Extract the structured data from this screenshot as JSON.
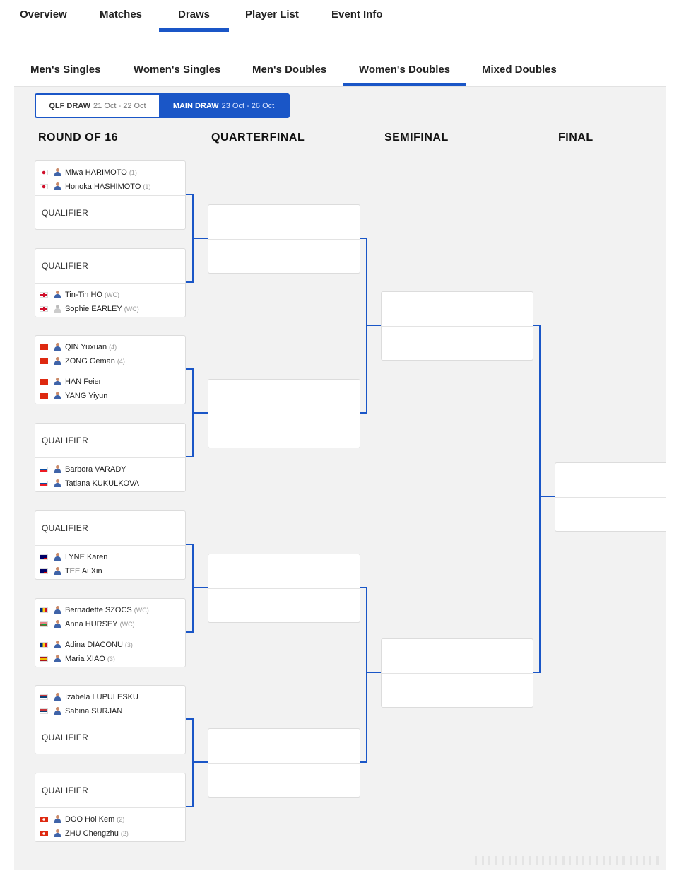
{
  "top_nav": {
    "items": [
      "Overview",
      "Matches",
      "Draws",
      "Player List",
      "Event Info"
    ],
    "active": "Draws"
  },
  "sub_tabs": {
    "items": [
      "Men's Singles",
      "Women's Singles",
      "Men's Doubles",
      "Women's Doubles",
      "Mixed Doubles"
    ],
    "active": "Women's Doubles"
  },
  "draw_toggle": {
    "qlf_label": "QLF DRAW",
    "qlf_dates": "21 Oct - 22 Oct",
    "main_label": "MAIN DRAW",
    "main_dates": "23 Oct - 26 Oct",
    "active": "MAIN DRAW"
  },
  "rounds": [
    "ROUND OF 16",
    "QUARTERFINAL",
    "SEMIFINAL",
    "FINAL"
  ],
  "colors": {
    "accent": "#1a56c7",
    "bracket_line": "#1a56c7",
    "background": "#f2f2f2"
  },
  "round_of_16": [
    {
      "slots": [
        {
          "type": "pair",
          "players": [
            {
              "name": "Miwa HARIMOTO",
              "seed": "(1)",
              "flag": "jp",
              "avatar": "photo"
            },
            {
              "name": "Honoka HASHIMOTO",
              "seed": "(1)",
              "flag": "jp",
              "avatar": "photo"
            }
          ]
        },
        {
          "type": "qualifier",
          "label": "QUALIFIER"
        }
      ]
    },
    {
      "slots": [
        {
          "type": "qualifier",
          "label": "QUALIFIER"
        },
        {
          "type": "pair",
          "players": [
            {
              "name": "Tin-Tin HO",
              "seed": "(WC)",
              "flag": "en",
              "avatar": "photo"
            },
            {
              "name": "Sophie EARLEY",
              "seed": "(WC)",
              "flag": "en",
              "avatar": "silhouette"
            }
          ]
        }
      ]
    },
    {
      "slots": [
        {
          "type": "pair",
          "players": [
            {
              "name": "QIN Yuxuan",
              "seed": "(4)",
              "flag": "cn",
              "avatar": "photo"
            },
            {
              "name": "ZONG Geman",
              "seed": "(4)",
              "flag": "cn",
              "avatar": "photo"
            }
          ]
        },
        {
          "type": "pair",
          "players": [
            {
              "name": "HAN Feier",
              "seed": "",
              "flag": "cn",
              "avatar": "photo"
            },
            {
              "name": "YANG Yiyun",
              "seed": "",
              "flag": "cn",
              "avatar": "photo"
            }
          ]
        }
      ]
    },
    {
      "slots": [
        {
          "type": "qualifier",
          "label": "QUALIFIER"
        },
        {
          "type": "pair",
          "players": [
            {
              "name": "Barbora VARADY",
              "seed": "",
              "flag": "sk",
              "avatar": "photo"
            },
            {
              "name": "Tatiana KUKULKOVA",
              "seed": "",
              "flag": "sk",
              "avatar": "photo"
            }
          ]
        }
      ]
    },
    {
      "slots": [
        {
          "type": "qualifier",
          "label": "QUALIFIER"
        },
        {
          "type": "pair",
          "players": [
            {
              "name": "LYNE Karen",
              "seed": "",
              "flag": "my",
              "avatar": "photo"
            },
            {
              "name": "TEE Ai Xin",
              "seed": "",
              "flag": "my",
              "avatar": "photo"
            }
          ]
        }
      ]
    },
    {
      "slots": [
        {
          "type": "pair",
          "players": [
            {
              "name": "Bernadette SZOCS",
              "seed": "(WC)",
              "flag": "ro",
              "avatar": "photo"
            },
            {
              "name": "Anna HURSEY",
              "seed": "(WC)",
              "flag": "wls",
              "avatar": "photo"
            }
          ]
        },
        {
          "type": "pair",
          "players": [
            {
              "name": "Adina DIACONU",
              "seed": "(3)",
              "flag": "ro",
              "avatar": "photo"
            },
            {
              "name": "Maria XIAO",
              "seed": "(3)",
              "flag": "es",
              "avatar": "photo"
            }
          ]
        }
      ]
    },
    {
      "slots": [
        {
          "type": "pair",
          "players": [
            {
              "name": "Izabela LUPULESKU",
              "seed": "",
              "flag": "rs",
              "avatar": "photo"
            },
            {
              "name": "Sabina SURJAN",
              "seed": "",
              "flag": "rs",
              "avatar": "photo"
            }
          ]
        },
        {
          "type": "qualifier",
          "label": "QUALIFIER"
        }
      ]
    },
    {
      "slots": [
        {
          "type": "qualifier",
          "label": "QUALIFIER"
        },
        {
          "type": "pair",
          "players": [
            {
              "name": "DOO Hoi Kem",
              "seed": "(2)",
              "flag": "hk",
              "avatar": "photo"
            },
            {
              "name": "ZHU Chengzhu",
              "seed": "(2)",
              "flag": "hk",
              "avatar": "photo"
            }
          ]
        }
      ]
    }
  ]
}
